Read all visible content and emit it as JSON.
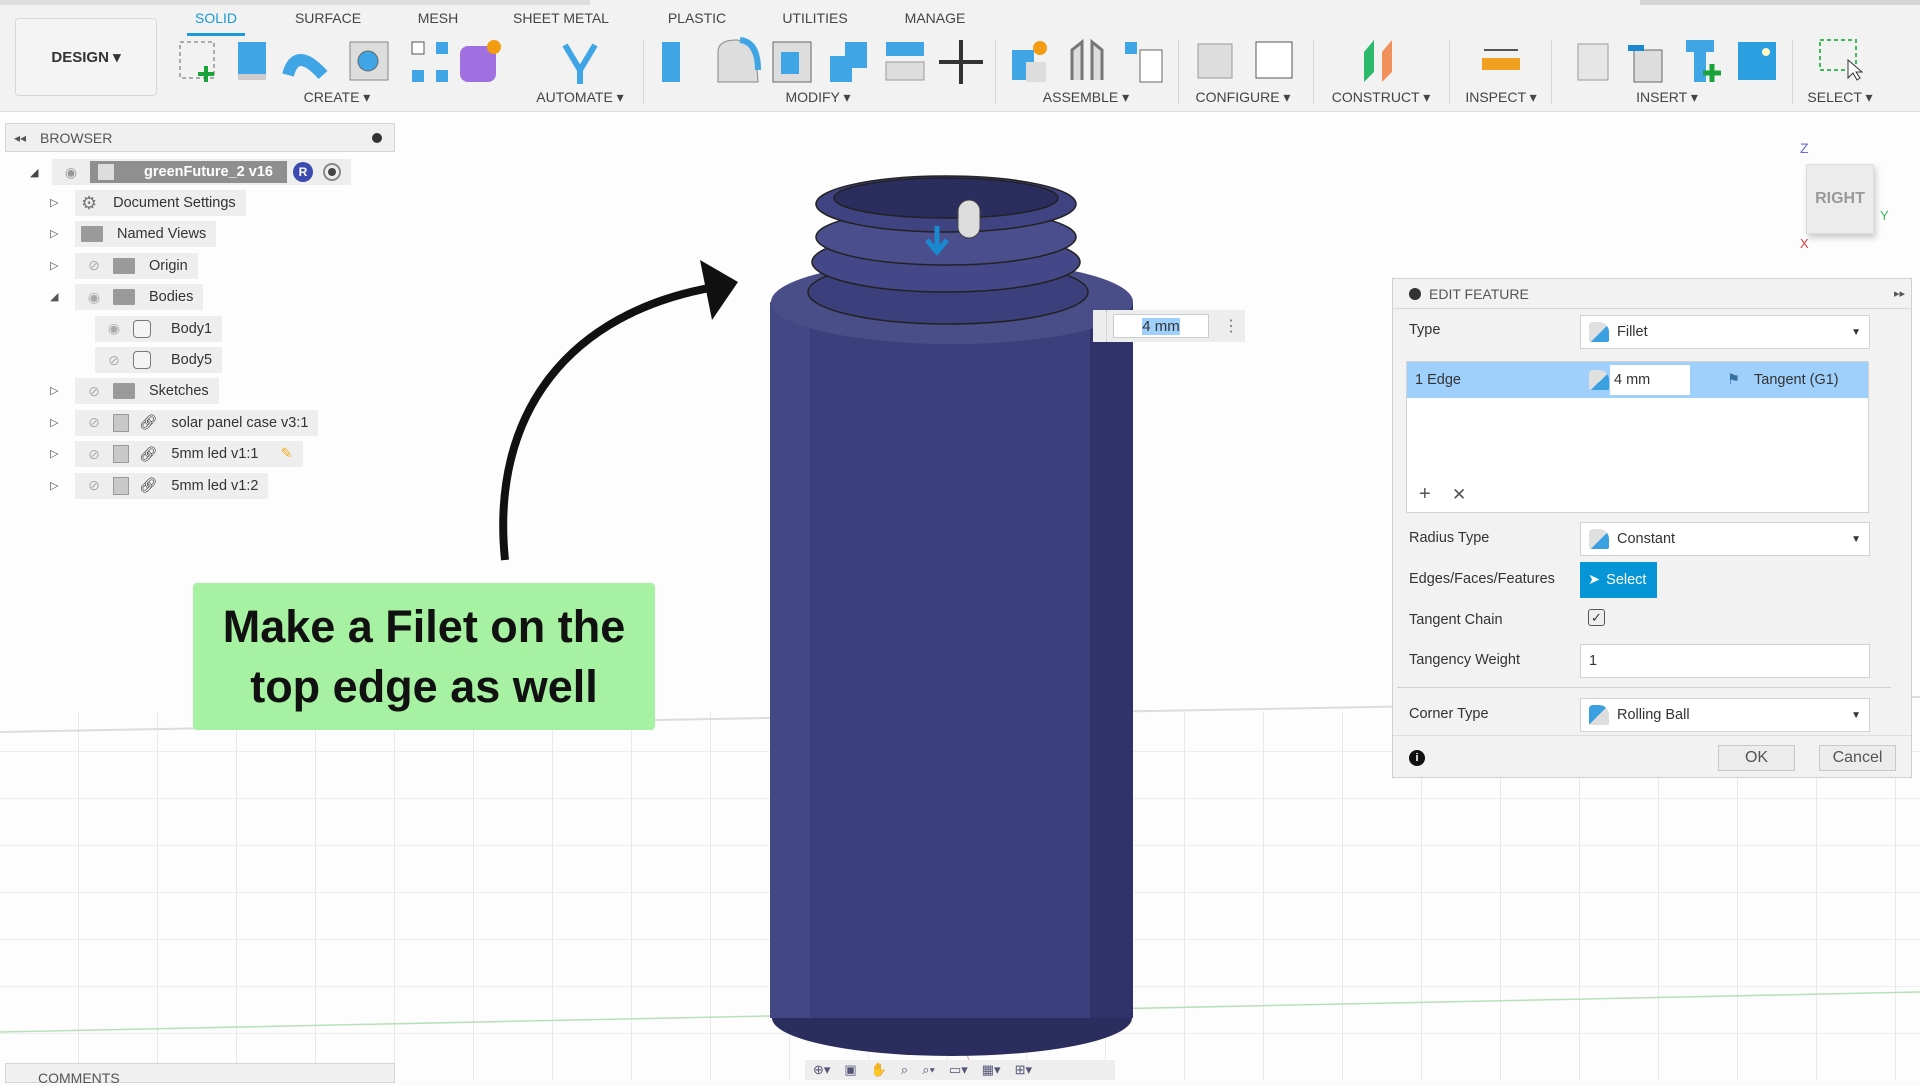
{
  "toolbar": {
    "workspace": "DESIGN",
    "tabs": [
      "SOLID",
      "SURFACE",
      "MESH",
      "SHEET METAL",
      "PLASTIC",
      "UTILITIES",
      "MANAGE"
    ],
    "active_tab": "SOLID",
    "groups": [
      "CREATE",
      "AUTOMATE",
      "MODIFY",
      "ASSEMBLE",
      "CONFIGURE",
      "CONSTRUCT",
      "INSPECT",
      "INSERT",
      "SELECT"
    ]
  },
  "browser": {
    "title": "BROWSER",
    "root": "greenFuture_2 v16",
    "root_badge": "R",
    "items": [
      {
        "label": "Document Settings",
        "icon": "gear-icon"
      },
      {
        "label": "Named Views",
        "icon": "folder-icon"
      },
      {
        "label": "Origin",
        "icon": "folder-icon",
        "visible": false
      },
      {
        "label": "Bodies",
        "icon": "folder-icon",
        "visible": true,
        "expanded": true
      },
      {
        "label": "Body1",
        "icon": "body-icon",
        "visible": true,
        "child": true
      },
      {
        "label": "Body5",
        "icon": "body-icon",
        "visible": false,
        "child": true
      },
      {
        "label": "Sketches",
        "icon": "folder-icon",
        "visible": false
      },
      {
        "label": "solar panel case v3:1",
        "icon": "component-icon",
        "visible": false,
        "linked": true
      },
      {
        "label": "5mm led v1:1",
        "icon": "component-icon",
        "visible": false,
        "linked": true,
        "editing": true
      },
      {
        "label": "5mm led v1:2",
        "icon": "component-icon",
        "visible": false,
        "linked": true
      }
    ]
  },
  "comments": {
    "title": "COMMENTS"
  },
  "callout": {
    "text": "Make a Filet on the\ntop edge as well",
    "color": "#a6f1a2"
  },
  "viewcube": {
    "face": "RIGHT",
    "axes": [
      "Z",
      "Y",
      "X"
    ]
  },
  "floating_input": {
    "value": "4 mm"
  },
  "edit_feature": {
    "title": "EDIT FEATURE",
    "type_label": "Type",
    "type_value": "Fillet",
    "edge_label": "1 Edge",
    "edge_radius": "4 mm",
    "edge_continuity": "Tangent (G1)",
    "radius_type_label": "Radius Type",
    "radius_type_value": "Constant",
    "efe_label": "Edges/Faces/Features",
    "select_label": "Select",
    "tangent_chain_label": "Tangent Chain",
    "tangent_chain": true,
    "tangency_weight_label": "Tangency Weight",
    "tangency_weight": "1",
    "corner_type_label": "Corner Type",
    "corner_type_value": "Rolling Ball",
    "ok": "OK",
    "cancel": "Cancel"
  },
  "colors": {
    "accent": "#1a9ad6",
    "body": "#3b3f7c",
    "select_btn": "#0696d7",
    "edge_row": "#9fd0fb"
  }
}
